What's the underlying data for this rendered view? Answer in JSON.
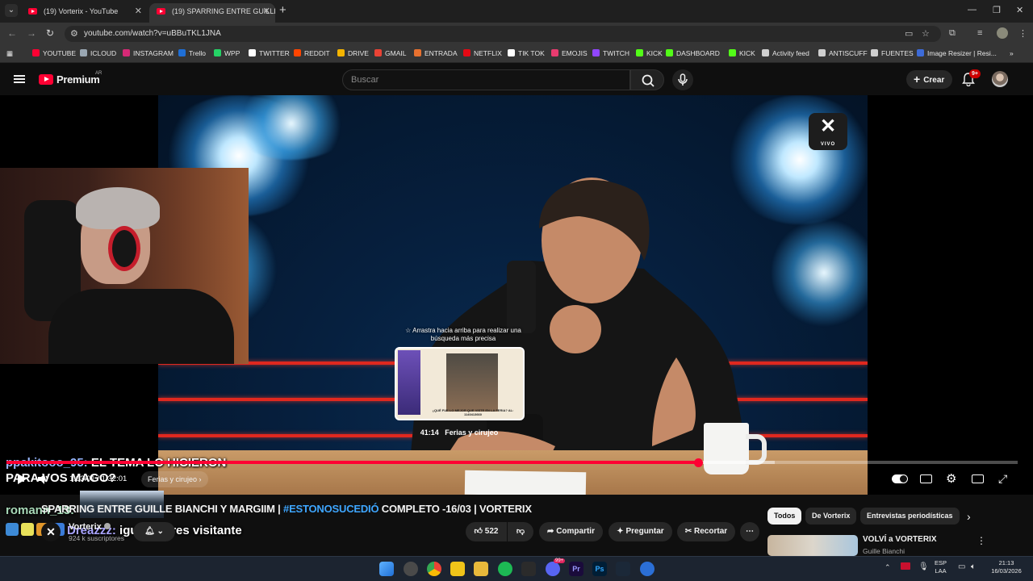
{
  "browser": {
    "tabs": [
      {
        "label": "(19) Vorterix - YouTube"
      },
      {
        "label": "(19) SPARRING ENTRE GUILLE B"
      }
    ],
    "url": "youtube.com/watch?v=uBBuTKL1JNA",
    "bookmarks": [
      {
        "label": "YOUTUBE",
        "color": "#ff0033"
      },
      {
        "label": "ICLOUD",
        "color": "#9aa7b3"
      },
      {
        "label": "INSTAGRAM",
        "color": "#d62976"
      },
      {
        "label": "Trello",
        "color": "#1f6fd6"
      },
      {
        "label": "WPP",
        "color": "#25d366"
      },
      {
        "label": "TWITTER",
        "color": "#ffffff"
      },
      {
        "label": "REDDIT",
        "color": "#ff4500"
      },
      {
        "label": "DRIVE",
        "color": "#f4b400"
      },
      {
        "label": "GMAIL",
        "color": "#ea4335"
      },
      {
        "label": "ENTRADA",
        "color": "#e8712f"
      },
      {
        "label": "NETFLIX",
        "color": "#e50914"
      },
      {
        "label": "TIK TOK",
        "color": "#ffffff"
      },
      {
        "label": "EMOJIS",
        "color": "#e83b6f"
      },
      {
        "label": "TWITCH",
        "color": "#9146ff"
      },
      {
        "label": "KICK",
        "color": "#53fc18"
      },
      {
        "label": "DASHBOARD",
        "color": "#53fc18"
      },
      {
        "label": "KICK",
        "color": "#53fc18"
      },
      {
        "label": "Activity feed",
        "color": "#cfcfcf"
      },
      {
        "label": "ANTISCUFF",
        "color": "#cfcfcf"
      },
      {
        "label": "FUENTES",
        "color": "#cfcfcf"
      },
      {
        "label": "Image Resizer | Resi...",
        "color": "#3d6bd8"
      }
    ]
  },
  "youtube": {
    "logo_text": "Premium",
    "logo_region": "AR",
    "search_placeholder": "Buscar",
    "create_label": "Crear",
    "notifications": "9+"
  },
  "overlay": {
    "chat": [
      {
        "user": "ppakitooo_95:",
        "text": " EL TEMA LO HICIERON PARA VOS MAGO?"
      },
      {
        "user": "romann_13:",
        "text": ""
      },
      {
        "user": "Dreazzz:",
        "text": " igual si eres visitante"
      }
    ],
    "hint": "☆ Arrastra hacia arriba para realizar una búsqueda más precisa",
    "preview_time": "41:14",
    "preview_chapter": "Ferias y cirujeo",
    "preview_caption": "¿QUÉ FUE LO MEJOR QUE VISTE EN LA FERIA? AL: 1140413660"
  },
  "player": {
    "current_time": "1:03:01",
    "duration": "1:32:01",
    "time_separator": " / ",
    "chapter": "Ferias y cirujeo",
    "progress": 0.684,
    "buffered": 0.76
  },
  "video": {
    "title_part1": "SPARRING ENTRE GUILLE BIANCHI Y MARGIIM | ",
    "title_hashtag": "#ESTONOSUCEDIÓ",
    "title_part2": " COMPLETO -16/03 | VORTERIX",
    "channel_name": "Vorterix",
    "subscribers": "924 k suscriptores",
    "likes": "522",
    "share_label": "Compartir",
    "ask_label": "Preguntar",
    "clip_label": "Recortar",
    "logo_text": "VIVO"
  },
  "sidebar": {
    "chips": [
      "Todos",
      "De Vorterix",
      "Entrevistas periodísticas"
    ],
    "recommendation": {
      "title": "VOLVÍ a VORTERIX",
      "channel": "Guille Bianchi"
    }
  },
  "taskbar": {
    "language": "ESP",
    "layout": "LAA",
    "time": "21:13",
    "date": "16/03/2026",
    "discord_badge": "99+"
  }
}
